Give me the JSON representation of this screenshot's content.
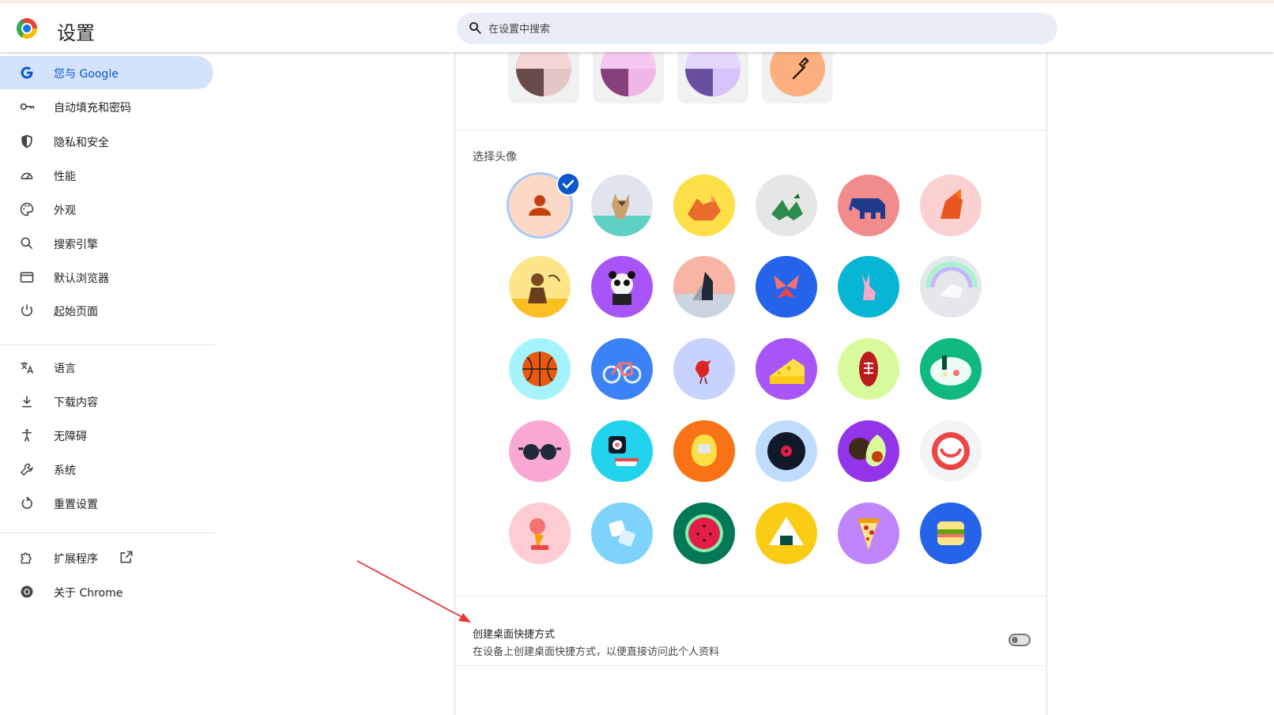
{
  "header": {
    "title": "设置",
    "search_placeholder": "在设置中搜索"
  },
  "sidebar": {
    "items": [
      {
        "label": "您与 Google",
        "icon": "google-g-icon",
        "active": true
      },
      {
        "label": "自动填充和密码",
        "icon": "key-icon"
      },
      {
        "label": "隐私和安全",
        "icon": "shield-icon"
      },
      {
        "label": "性能",
        "icon": "speedometer-icon"
      },
      {
        "label": "外观",
        "icon": "palette-icon"
      },
      {
        "label": "搜索引擎",
        "icon": "search-icon"
      },
      {
        "label": "默认浏览器",
        "icon": "browser-window-icon"
      },
      {
        "label": "起始页面",
        "icon": "power-icon"
      },
      {
        "label": "语言",
        "icon": "translate-icon"
      },
      {
        "label": "下载内容",
        "icon": "download-icon"
      },
      {
        "label": "无障碍",
        "icon": "accessibility-icon"
      },
      {
        "label": "系统",
        "icon": "wrench-icon"
      },
      {
        "label": "重置设置",
        "icon": "reset-icon"
      },
      {
        "label": "扩展程序",
        "icon": "puzzle-icon"
      },
      {
        "label": "关于 Chrome",
        "icon": "chrome-icon"
      }
    ]
  },
  "panel": {
    "avatar_section_label": "选择头像",
    "shortcut": {
      "title": "创建桌面快捷方式",
      "description": "在设备上创建桌面快捷方式，以便直接访问此个人资料",
      "enabled": false
    }
  },
  "colors": {
    "accent": "#0b57d0",
    "active_nav_bg": "#d3e3fd",
    "search_bg": "#e9eef6",
    "arrow": "#e53935"
  }
}
